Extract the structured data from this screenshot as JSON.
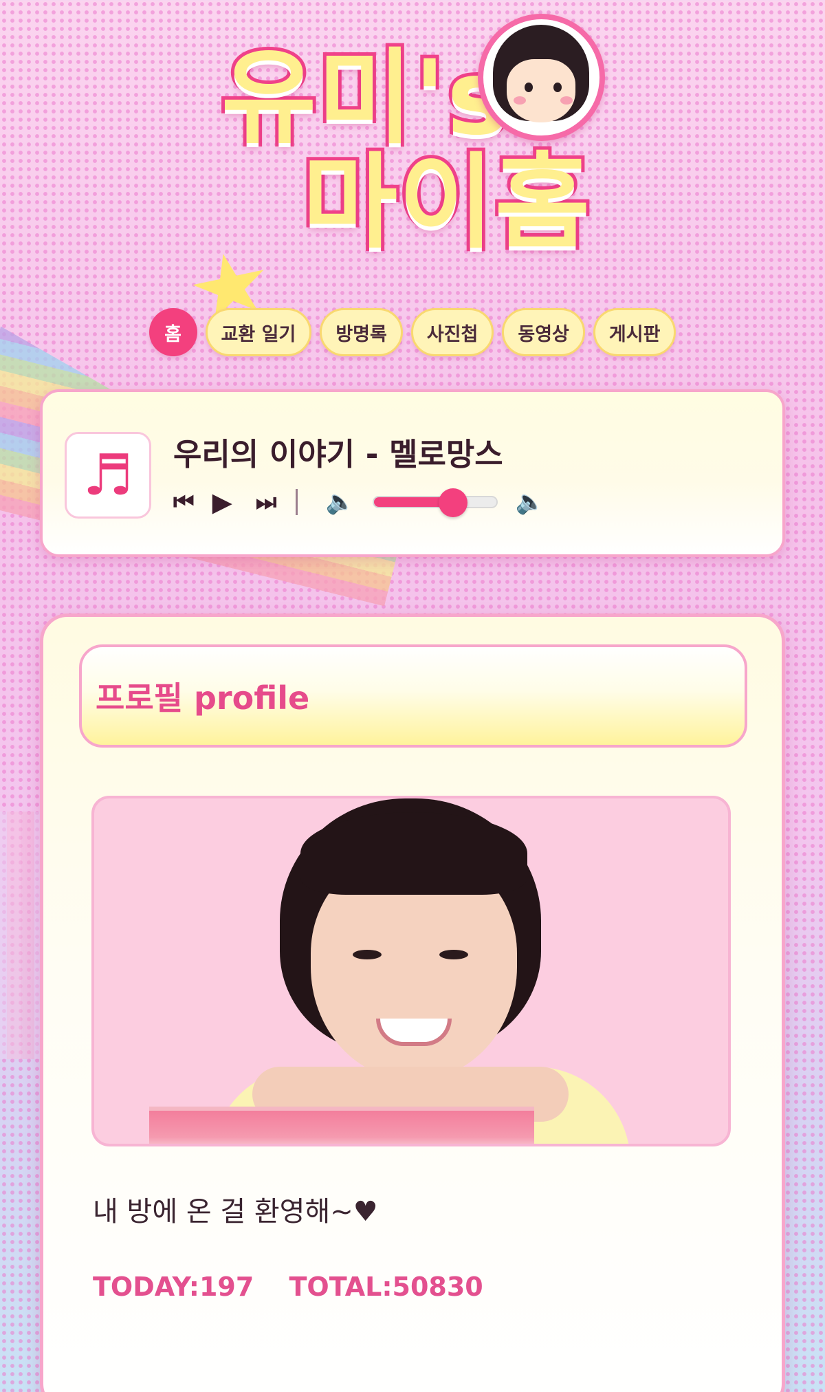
{
  "header": {
    "title_line1": "유미's",
    "title_line2": "마이홈"
  },
  "nav": {
    "tabs": [
      {
        "label": "홈",
        "active": true
      },
      {
        "label": "교환 일기"
      },
      {
        "label": "방명록"
      },
      {
        "label": "사진첩"
      },
      {
        "label": "동영상"
      },
      {
        "label": "게시판"
      }
    ]
  },
  "player": {
    "cover_glyph": "♬",
    "song_title": "우리의 이야기 - 멜로망스",
    "prev_icon": "⏮",
    "play_icon": "▶",
    "next_icon": "⏭",
    "volume_icon": "🔈",
    "volume_level": 0.65,
    "accent_color": "#f3407e"
  },
  "profile": {
    "heading": "프로필 profile",
    "welcome_text": "내 방에 온 걸 환영해~♥",
    "today_label": "TODAY:197",
    "total_label": "TOTAL:50830"
  },
  "colors": {
    "brand_pink": "#f3407e",
    "tab_yellow": "#fff4b8",
    "card_border": "#f7a6cb"
  }
}
